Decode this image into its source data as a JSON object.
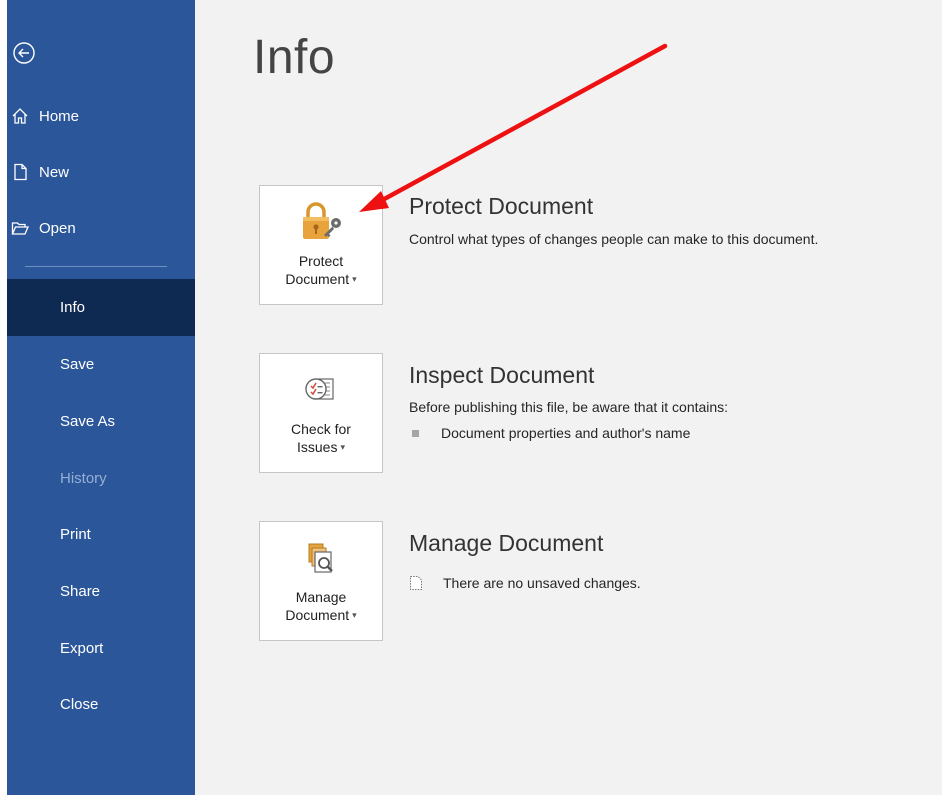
{
  "sidebar": {
    "top_items": [
      {
        "label": "Home",
        "icon": "home-icon"
      },
      {
        "label": "New",
        "icon": "new-document-icon"
      },
      {
        "label": "Open",
        "icon": "open-folder-icon"
      }
    ],
    "items": [
      {
        "label": "Info",
        "active": true
      },
      {
        "label": "Save"
      },
      {
        "label": "Save As"
      },
      {
        "label": "History",
        "disabled": true
      },
      {
        "label": "Print"
      },
      {
        "label": "Share"
      },
      {
        "label": "Export"
      },
      {
        "label": "Close"
      }
    ]
  },
  "main": {
    "title": "Info",
    "sections": [
      {
        "button_line1": "Protect",
        "button_line2": "Document",
        "title": "Protect Document",
        "description": "Control what types of changes people can make to this document.",
        "icon": "lock-key-icon"
      },
      {
        "button_line1": "Check for",
        "button_line2": "Issues",
        "title": "Inspect Document",
        "description": "Before publishing this file, be aware that it contains:",
        "bullet": "Document properties and author's name",
        "icon": "inspect-checklist-icon"
      },
      {
        "button_line1": "Manage",
        "button_line2": "Document",
        "title": "Manage Document",
        "status": "There are no unsaved changes.",
        "icon": "manage-documents-icon"
      }
    ]
  },
  "colors": {
    "sidebar_bg": "#2b579a",
    "sidebar_active": "#0f2a52",
    "main_bg": "#f2f2f2",
    "annotation_arrow": "#ee1111",
    "lock_gold": "#e8a33d"
  }
}
